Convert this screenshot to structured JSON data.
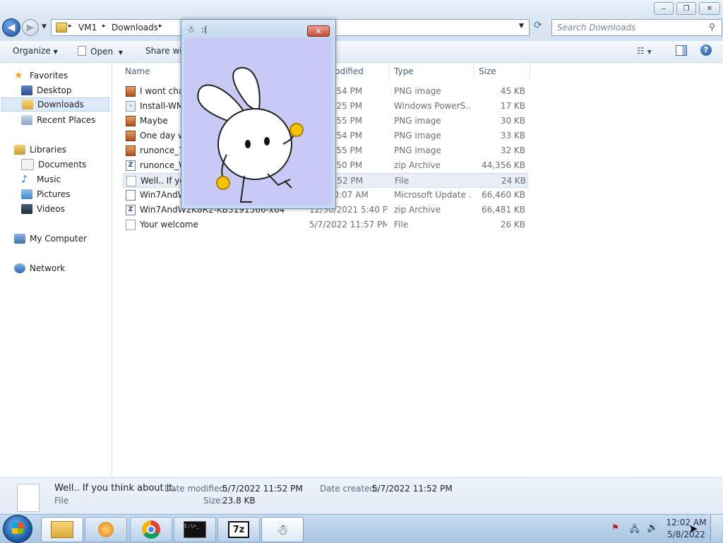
{
  "window": {
    "buttons": {
      "minimize": "‒",
      "maximize": "❐",
      "close": "✕"
    }
  },
  "address": {
    "crumbs": [
      "VM1",
      "Downloads"
    ],
    "search_placeholder": "Search Downloads"
  },
  "toolbar": {
    "organize": "Organize",
    "open": "Open",
    "share_with": "Share with"
  },
  "nav": {
    "favorites": "Favorites",
    "desktop": "Desktop",
    "downloads": "Downloads",
    "recent_places": "Recent Places",
    "libraries": "Libraries",
    "documents": "Documents",
    "music": "Music",
    "pictures": "Pictures",
    "videos": "Videos",
    "my_computer": "My Computer",
    "network": "Network"
  },
  "columns": {
    "name": "Name",
    "date_modified": "odified",
    "type": "Type",
    "size": "Size"
  },
  "files": [
    {
      "name": "I wont char",
      "date": "22 11:54 PM",
      "type": "PNG image",
      "size": "45 KB",
      "icon": "png-icon"
    },
    {
      "name": "Install-WM",
      "date": "017 3:25 PM",
      "type": "Windows PowerS...",
      "size": "17 KB",
      "icon": "powershell-icon"
    },
    {
      "name": "Maybe",
      "date": "22 11:55 PM",
      "type": "PNG image",
      "size": "30 KB",
      "icon": "png-icon"
    },
    {
      "name": "One day w",
      "date": "22 11:54 PM",
      "type": "PNG image",
      "size": "33 KB",
      "icon": "png-icon"
    },
    {
      "name": "runonce_70",
      "date": "22 11:55 PM",
      "type": "PNG image",
      "size": "32 KB",
      "icon": "png-icon"
    },
    {
      "name": "runonce_W",
      "date": "22 11:50 PM",
      "type": "zip Archive",
      "size": "44,356 KB",
      "icon": "zip-icon"
    },
    {
      "name": "Well.. If you",
      "date": "22 11:52 PM",
      "type": "File",
      "size": "24 KB",
      "icon": "file-icon"
    },
    {
      "name": "Win7AndW",
      "date": "017 10:07 AM",
      "type": "Microsoft Update ...",
      "size": "66,460 KB",
      "icon": "msu-icon"
    },
    {
      "name": "Win7AndW2K8R2-KB3191566-x64",
      "date": "12/30/2021 5:40 PM",
      "type": "zip Archive",
      "size": "66,481 KB",
      "icon": "zip-icon"
    },
    {
      "name": "Your welcome",
      "date": "5/7/2022 11:57 PM",
      "type": "File",
      "size": "26 KB",
      "icon": "file-icon"
    }
  ],
  "details": {
    "name": "Well.. If you think about it.",
    "kind": "File",
    "date_modified_label": "Date modified:",
    "date_modified": "5/7/2022 11:52 PM",
    "date_created_label": "Date created:",
    "date_created": "5/7/2022 11:52 PM",
    "size_label": "Size:",
    "size": "23.8 KB"
  },
  "popup": {
    "title": ":(",
    "close": "✕"
  },
  "taskbar": {
    "time": "12:02 AM",
    "date": "5/8/2022",
    "apps": [
      "start-orb",
      "explorer",
      "media-player",
      "chrome",
      "cmd",
      "7zip",
      "bunny-app"
    ],
    "sevenzip_label": "7z",
    "cmd_label": "C:\\>_"
  },
  "colors": {
    "accent": "#3a6ea5",
    "popup_body": "#c9c9f5",
    "selection": "#dce9f8"
  }
}
